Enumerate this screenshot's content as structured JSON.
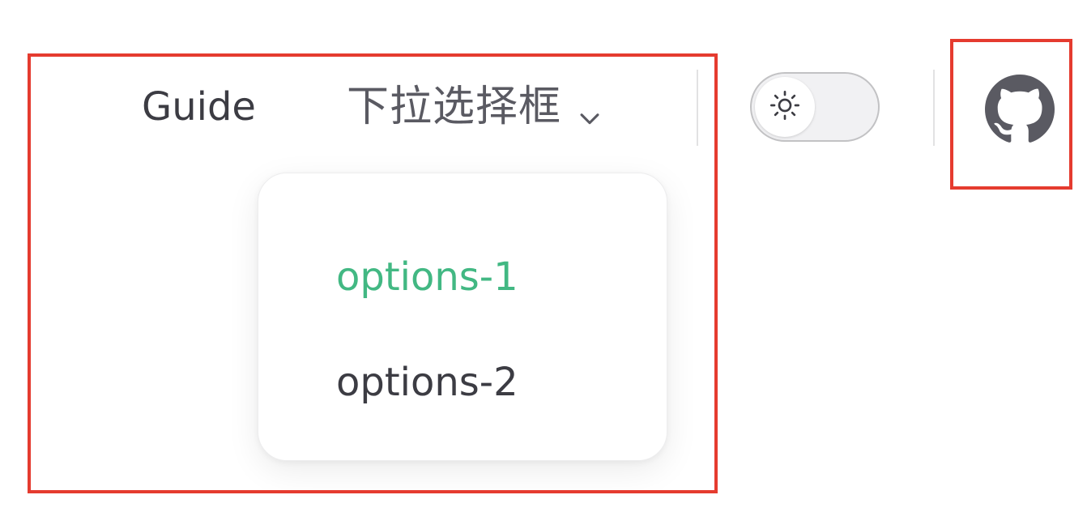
{
  "nav": {
    "guide_label": "Guide",
    "dropdown_label": "下拉选择框",
    "dropdown_icon": "chevron-down-icon"
  },
  "dropdown": {
    "items": [
      {
        "label": "options-1",
        "active": true
      },
      {
        "label": "options-2",
        "active": false
      }
    ]
  },
  "theme_toggle": {
    "icon": "sun-icon",
    "mode": "light"
  },
  "github": {
    "icon": "github-icon"
  },
  "colors": {
    "accent": "#42b883",
    "text": "#3c3c43",
    "highlight": "#e53b2f"
  }
}
